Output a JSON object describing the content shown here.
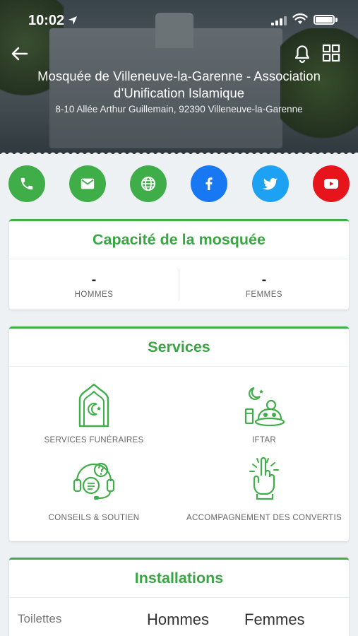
{
  "status_bar": {
    "time": "10:02"
  },
  "header": {
    "title": "Mosquée de Villeneuve-la-Garenne - Association d’Unification Islamique",
    "address": "8-10 Allée Arthur Guillemain, 92390 Villeneuve-la-Garenne"
  },
  "contacts": [
    {
      "name": "phone-icon",
      "color": "#3fae49"
    },
    {
      "name": "mail-icon",
      "color": "#3fae49"
    },
    {
      "name": "globe-icon",
      "color": "#3fae49"
    },
    {
      "name": "facebook-icon",
      "color": "#1877f2"
    },
    {
      "name": "twitter-icon",
      "color": "#1da1f2"
    },
    {
      "name": "youtube-icon",
      "color": "#e8141c"
    }
  ],
  "capacity": {
    "title": "Capacité de la mosquée",
    "men_value": "-",
    "men_label": "HOMMES",
    "women_value": "-",
    "women_label": "FEMMES"
  },
  "services": {
    "title": "Services",
    "items": [
      {
        "label": "SERVICES FUNÉRAIRES",
        "icon": "mosque-crescent-icon"
      },
      {
        "label": "IFTAR",
        "icon": "iftar-meal-icon"
      },
      {
        "label": "CONSEILS & SOUTIEN",
        "icon": "support-headset-icon"
      },
      {
        "label": "ACCOMPAGNEMENT DES CONVERTIS",
        "icon": "raised-finger-icon"
      }
    ]
  },
  "installations": {
    "title": "Installations",
    "row_label": "Toilettes",
    "men_header": "Hommes",
    "women_header": "Femmes"
  },
  "colors": {
    "accent": "#3fae49",
    "background": "#eef1f4"
  }
}
